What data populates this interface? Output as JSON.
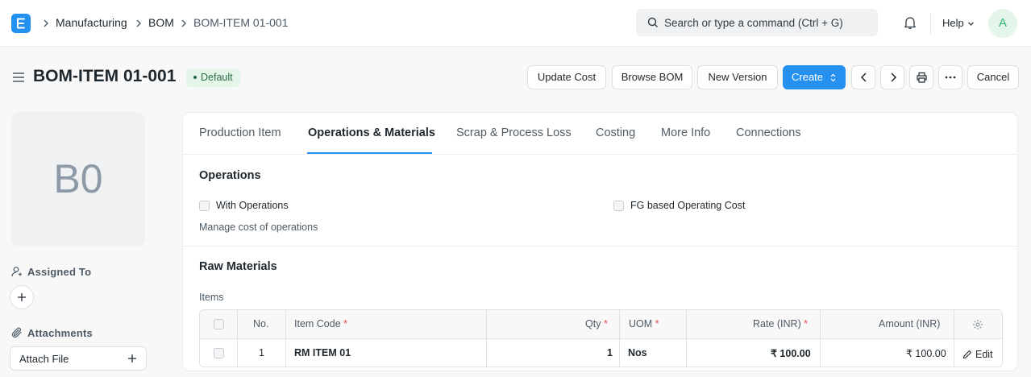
{
  "navbar": {
    "breadcrumbs": [
      "Manufacturing",
      "BOM",
      "BOM-ITEM 01-001"
    ],
    "search_placeholder": "Search or type a command (Ctrl + G)",
    "help_label": "Help",
    "avatar_initial": "A"
  },
  "page": {
    "title": "BOM-ITEM 01-001",
    "status_badge": "Default"
  },
  "actions": {
    "update_cost": "Update Cost",
    "browse_bom": "Browse BOM",
    "new_version": "New Version",
    "create": "Create",
    "cancel": "Cancel"
  },
  "sidebar": {
    "image_initials": "B0",
    "assigned_to_label": "Assigned To",
    "attachments_label": "Attachments",
    "attach_file_label": "Attach File"
  },
  "tabs": [
    {
      "label": "Production Item",
      "active": false
    },
    {
      "label": "Operations & Materials",
      "active": true
    },
    {
      "label": "Scrap & Process Loss",
      "active": false
    },
    {
      "label": "Costing",
      "active": false
    },
    {
      "label": "More Info",
      "active": false
    },
    {
      "label": "Connections",
      "active": false
    }
  ],
  "operations": {
    "title": "Operations",
    "with_operations_label": "With Operations",
    "with_operations_checked": false,
    "fg_based_label": "FG based Operating Cost",
    "fg_based_checked": false,
    "description": "Manage cost of operations"
  },
  "raw_materials": {
    "title": "Raw Materials",
    "items_label": "Items",
    "columns": {
      "no": "No.",
      "item_code": "Item Code",
      "qty": "Qty",
      "uom": "UOM",
      "rate": "Rate (INR)",
      "amount": "Amount (INR)"
    },
    "required_marker": "*",
    "rows": [
      {
        "no": "1",
        "item_code": "RM ITEM 01",
        "qty": "1",
        "uom": "Nos",
        "rate": "₹ 100.00",
        "amount": "₹ 100.00",
        "edit_label": "Edit"
      }
    ]
  },
  "colors": {
    "primary": "#2490ef",
    "badge_bg": "#e4f5e9",
    "badge_text": "#2b6e4a",
    "required": "#e24c4c"
  },
  "icons": [
    "logo-icon",
    "chevron-right-icon",
    "search-icon",
    "bell-icon",
    "chevron-down-icon",
    "hamburger-icon",
    "sort-icon",
    "chevron-left-icon",
    "printer-icon",
    "more-icon",
    "user-add-icon",
    "plus-icon",
    "paperclip-icon",
    "gear-icon",
    "pencil-icon"
  ]
}
